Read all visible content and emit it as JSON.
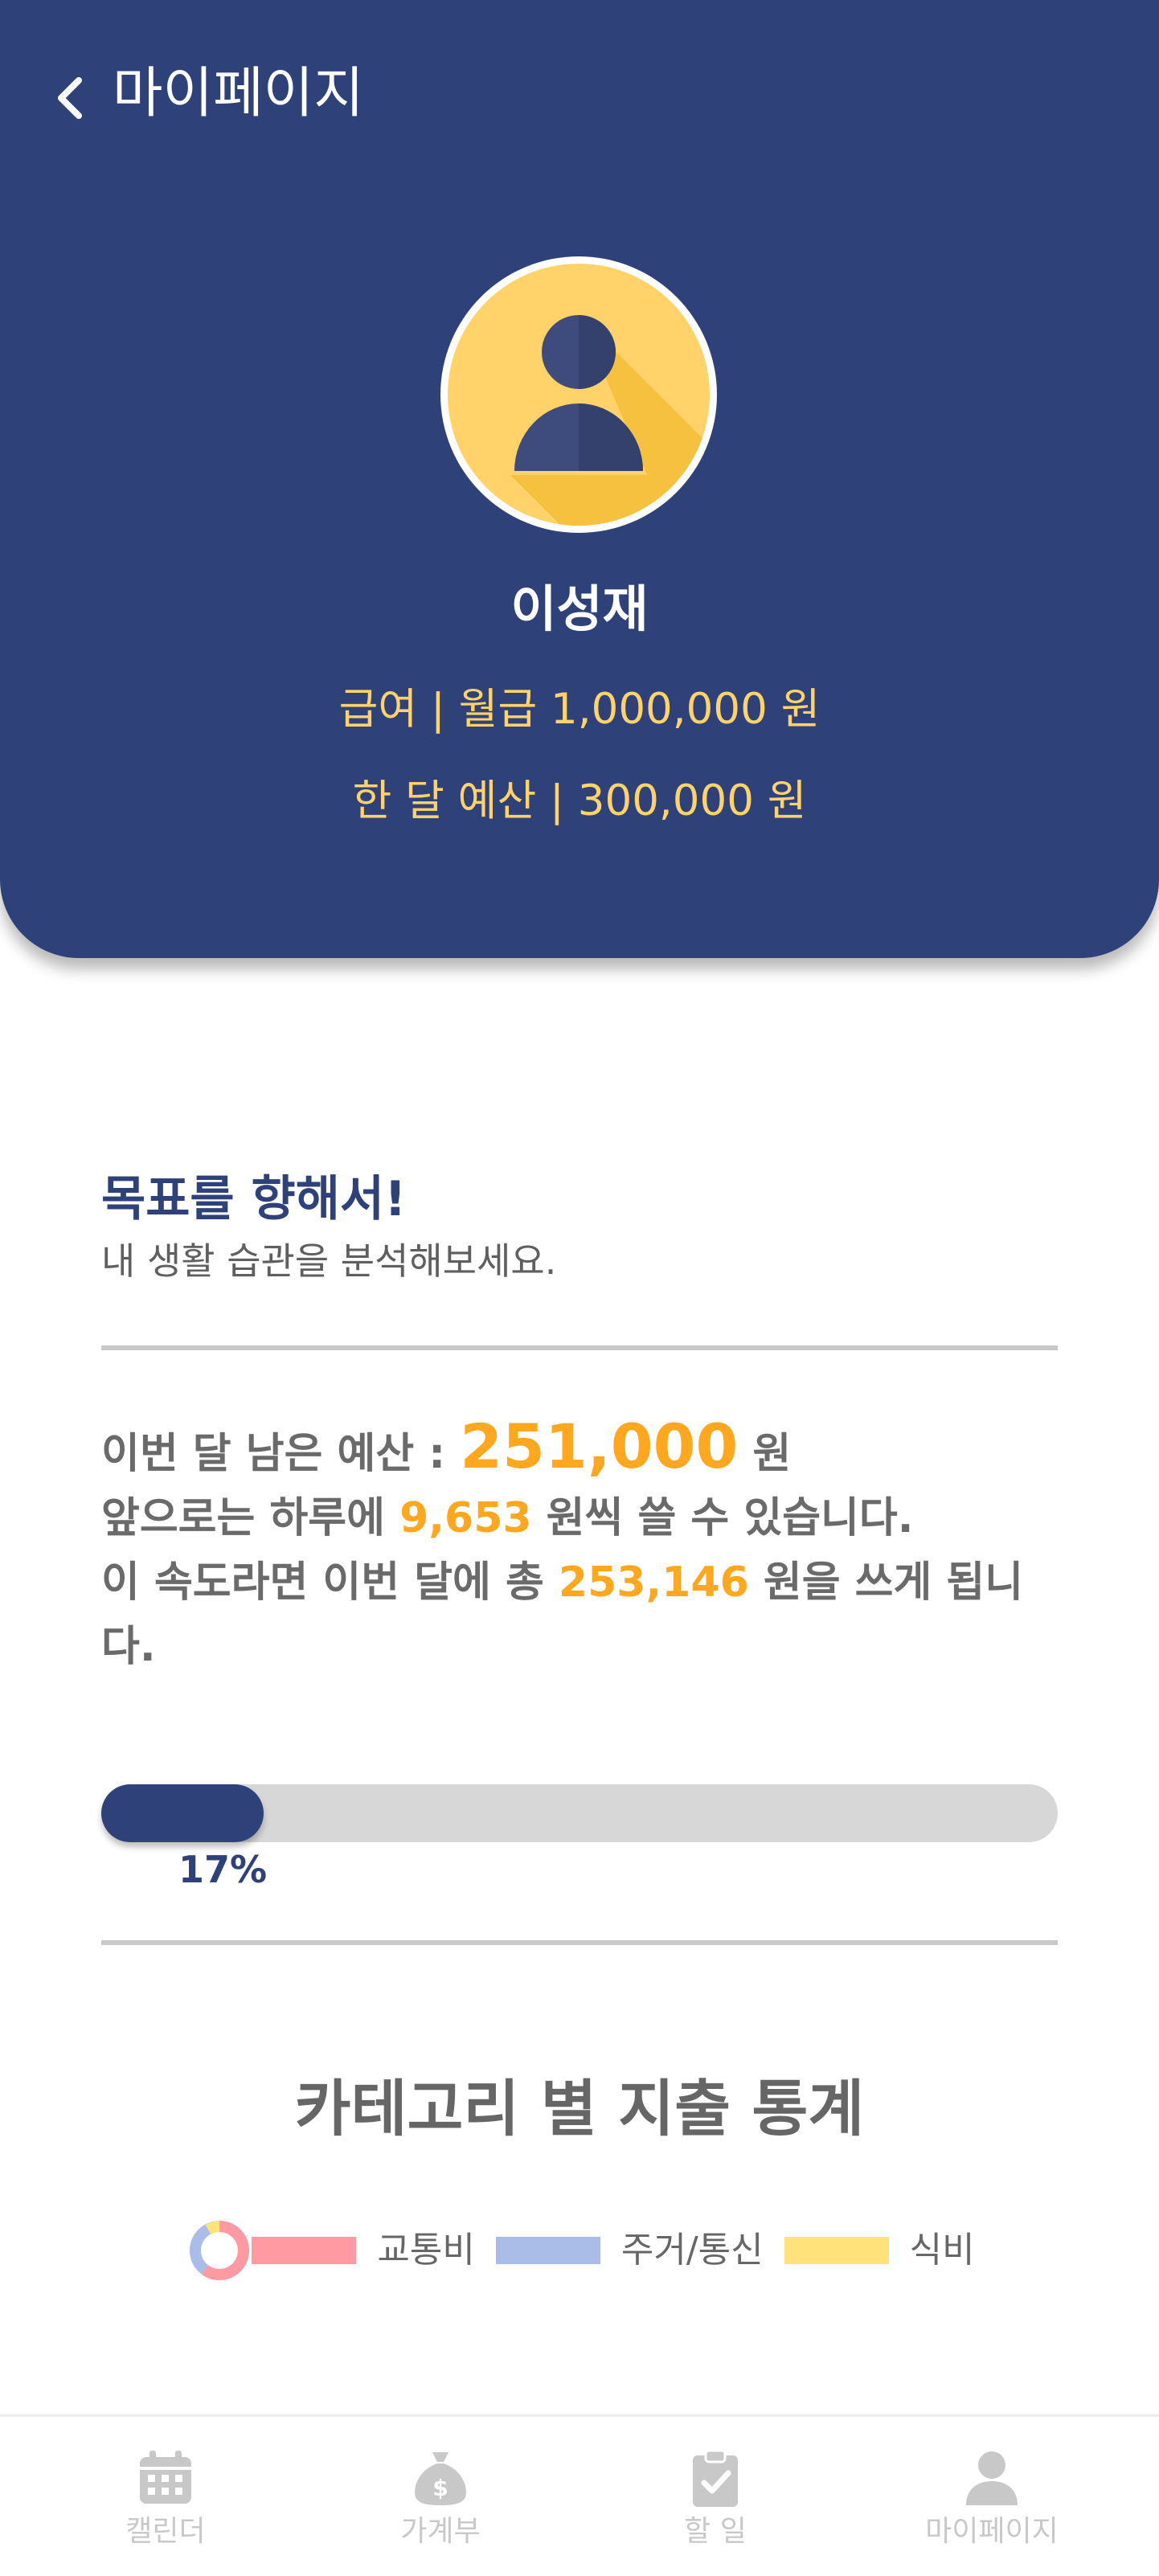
{
  "header": {
    "title": "마이페이지",
    "user_name": "이성재",
    "salary_text": "급여 | 월급 1,000,000 원",
    "budget_text": "한 달 예산 | 300,000 원"
  },
  "goal": {
    "title": "목표를 향해서!",
    "subtitle": "내 생활 습관을 분석해보세요."
  },
  "stats": {
    "remaining_prefix": "이번 달 남은 예산 : ",
    "remaining_amount": "251,000",
    "remaining_suffix": " 원",
    "daily_prefix": "앞으로는 하루에 ",
    "daily_amount": "9,653",
    "daily_suffix": " 원씩 쓸 수 있습니다.",
    "pace_prefix": "이 속도라면 이번 달에 총 ",
    "pace_amount": "253,146",
    "pace_suffix_line1": " 원을 쓰게 됩니",
    "pace_suffix_line2": "다."
  },
  "progress": {
    "percent": 17,
    "label": "17%"
  },
  "category": {
    "title": "카테고리 별 지출 통계",
    "legend": [
      {
        "label": "교통비",
        "color": "#ff9aa2"
      },
      {
        "label": "주거/통신",
        "color": "#a9bde8"
      },
      {
        "label": "식비",
        "color": "#ffe27a"
      }
    ]
  },
  "tabbar": {
    "items": [
      {
        "label": "캘린더",
        "icon": "calendar-icon"
      },
      {
        "label": "가계부",
        "icon": "money-bag-icon"
      },
      {
        "label": "할 일",
        "icon": "clipboard-check-icon"
      },
      {
        "label": "마이페이지",
        "icon": "person-icon"
      }
    ]
  },
  "colors": {
    "primary": "#2e4279",
    "accent": "#ffa81f",
    "header_text_accent": "#ffd36a"
  }
}
